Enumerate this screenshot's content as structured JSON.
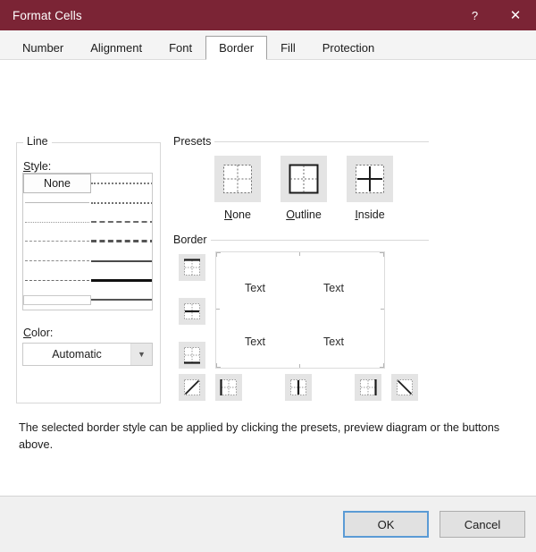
{
  "window": {
    "title": "Format Cells",
    "titlebar_color": "#7b2435",
    "help_icon": "question-mark-icon",
    "close_icon": "close-icon"
  },
  "tabs": [
    {
      "label": "Number",
      "active": false
    },
    {
      "label": "Alignment",
      "active": false
    },
    {
      "label": "Font",
      "active": false
    },
    {
      "label": "Border",
      "active": true
    },
    {
      "label": "Fill",
      "active": false
    },
    {
      "label": "Protection",
      "active": false
    }
  ],
  "line": {
    "group_label": "Line",
    "style_label": "Style:",
    "style_accel": "S",
    "none_label": "None",
    "selected_style": "None",
    "styles_left": [
      {
        "id": "none",
        "kind": "none"
      },
      {
        "id": "hairline",
        "kind": "line",
        "border": "1px solid #b9b9b9"
      },
      {
        "id": "fine-dotted",
        "kind": "line",
        "border": "1px dotted #9a9a9a"
      },
      {
        "id": "dash-dot-thin",
        "kind": "line",
        "border": "1px dashed #8f8f8f"
      },
      {
        "id": "dash-dot-dot",
        "kind": "line",
        "border": "1px dashed #8a8a8a"
      },
      {
        "id": "dashed-medium",
        "kind": "line",
        "border": "1px dashed #6a6a6a"
      },
      {
        "id": "blank-box",
        "kind": "box"
      }
    ],
    "styles_right": [
      {
        "id": "dotted-dense",
        "kind": "line",
        "border": "2px dotted #7a7a7a"
      },
      {
        "id": "dash-dot-fine",
        "kind": "line",
        "border": "2px dotted #6e6e6e"
      },
      {
        "id": "dash-dot",
        "kind": "line",
        "border": "2px dashed #6a6a6a"
      },
      {
        "id": "dashed-bold",
        "kind": "line",
        "border": "3px dashed #555555"
      },
      {
        "id": "thin-solid",
        "kind": "line",
        "border": "2px solid #4a4a4a"
      },
      {
        "id": "thick-solid",
        "kind": "line",
        "border": "3px solid #111111"
      },
      {
        "id": "medium-solid",
        "kind": "line",
        "border": "2px solid #555555"
      }
    ],
    "color_label": "Color:",
    "color_accel": "C",
    "color_value": "Automatic",
    "color_arrow_icon": "chevron-down-icon"
  },
  "presets": {
    "group_label": "Presets",
    "items": [
      {
        "label": "None",
        "accel": "N",
        "icon": "preset-none-icon"
      },
      {
        "label": "Outline",
        "accel": "O",
        "icon": "preset-outline-icon"
      },
      {
        "label": "Inside",
        "accel": "I",
        "icon": "preset-inside-icon"
      }
    ]
  },
  "border": {
    "group_label": "Border",
    "buttons": [
      {
        "id": "top",
        "icon": "border-top-icon"
      },
      {
        "id": "horizontal",
        "icon": "border-horizontal-icon"
      },
      {
        "id": "bottom",
        "icon": "border-bottom-icon"
      },
      {
        "id": "diag-up",
        "icon": "border-diagonal-up-icon"
      },
      {
        "id": "left",
        "icon": "border-left-icon"
      },
      {
        "id": "vertical",
        "icon": "border-vertical-icon"
      },
      {
        "id": "right",
        "icon": "border-right-icon"
      },
      {
        "id": "diag-down",
        "icon": "border-diagonal-down-icon"
      }
    ],
    "preview": {
      "cells": [
        "Text",
        "Text",
        "Text",
        "Text"
      ]
    }
  },
  "description": "The selected border style can be applied by clicking the presets, preview diagram or the buttons above.",
  "footer": {
    "ok_label": "OK",
    "cancel_label": "Cancel",
    "focus_color": "#5b9bd5"
  }
}
